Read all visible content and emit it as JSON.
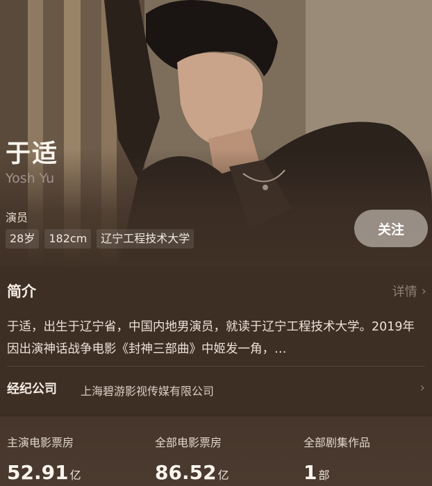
{
  "profile": {
    "name": "于适",
    "name_en": "Yosh Yu",
    "role": "演员",
    "tags": [
      "28岁",
      "182cm",
      "辽宁工程技术大学"
    ],
    "follow_label": "关注"
  },
  "intro": {
    "title": "简介",
    "details_label": "详情",
    "text": "于适，出生于辽宁省，中国内地男演员，就读于辽宁工程技术大学。2019年因出演神话战争电影《封神三部曲》中姬发一角，…"
  },
  "agency": {
    "label": "经纪公司",
    "value": "上海碧游影视传媒有限公司"
  },
  "stats": [
    {
      "label": "主演电影票房",
      "value": "52.91",
      "unit": "亿"
    },
    {
      "label": "全部电影票房",
      "value": "86.52",
      "unit": "亿"
    },
    {
      "label": "全部剧集作品",
      "value": "1",
      "unit": "部"
    }
  ],
  "colors": {
    "background": "#3e2f25",
    "accent_text": "#f6eee6",
    "muted_text": "#8d7f74"
  }
}
